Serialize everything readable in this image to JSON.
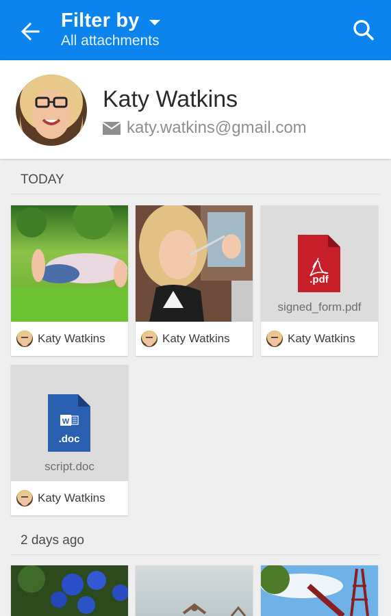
{
  "appbar": {
    "title": "Filter by",
    "subtitle": "All attachments",
    "back_icon": "arrow-back-icon",
    "search_icon": "search-icon",
    "color": "#0b84ee"
  },
  "profile": {
    "name": "Katy Watkins",
    "email": "katy.watkins@gmail.com",
    "mail_icon": "mail-icon"
  },
  "sections": [
    {
      "label": "TODAY",
      "items": [
        {
          "type": "photo",
          "sender": "Katy Watkins"
        },
        {
          "type": "photo",
          "sender": "Katy Watkins"
        },
        {
          "type": "file",
          "badge": ".pdf",
          "filename": "signed_form.pdf",
          "sender": "Katy Watkins",
          "color": "#c8202a"
        },
        {
          "type": "file",
          "badge": ".doc",
          "filename": "script.doc",
          "sender": "Katy Watkins",
          "color": "#2b5fb0"
        }
      ]
    },
    {
      "label": "2 days ago",
      "items": [
        {
          "type": "photo"
        },
        {
          "type": "photo"
        },
        {
          "type": "photo"
        }
      ]
    }
  ]
}
